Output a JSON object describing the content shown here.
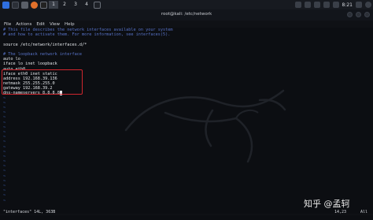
{
  "taskbar": {
    "workspaces": [
      "1",
      "2",
      "3",
      "4"
    ],
    "clock": "8:21",
    "accent": "#4b8bf5"
  },
  "window": {
    "title": "root@kali: /etc/network"
  },
  "menu": [
    "File",
    "Actions",
    "Edit",
    "View",
    "Help"
  ],
  "editor": {
    "lines": [
      {
        "text": "# This file describes the network interfaces available on your system",
        "kind": "comment"
      },
      {
        "text": "# and how to activate them. For more information, see interfaces(5).",
        "kind": "comment"
      },
      {
        "text": "",
        "kind": "normal"
      },
      {
        "text": "source /etc/network/interfaces.d/*",
        "kind": "normal"
      },
      {
        "text": "",
        "kind": "normal"
      },
      {
        "text": "# The loopback network interface",
        "kind": "comment"
      },
      {
        "text": "auto lo",
        "kind": "normal"
      },
      {
        "text": "iface lo inet loopback",
        "kind": "normal"
      },
      {
        "text": "auto eth0",
        "kind": "normal"
      },
      {
        "text": "iface eth0 inet static",
        "kind": "normal"
      },
      {
        "text": "address 192.168.39.136",
        "kind": "normal"
      },
      {
        "text": "netmask 255.255.255.0",
        "kind": "normal"
      },
      {
        "text": "gateway 192.168.39.2",
        "kind": "normal"
      },
      {
        "text": "dns-nameservers 8.8.8.8",
        "kind": "normal",
        "cursor": true
      }
    ],
    "tilde": "~",
    "status_file": "\"interfaces\" 14L, 363B",
    "status_position": "14,23",
    "status_scroll": "All"
  },
  "watermark": "知乎 @孟轲"
}
